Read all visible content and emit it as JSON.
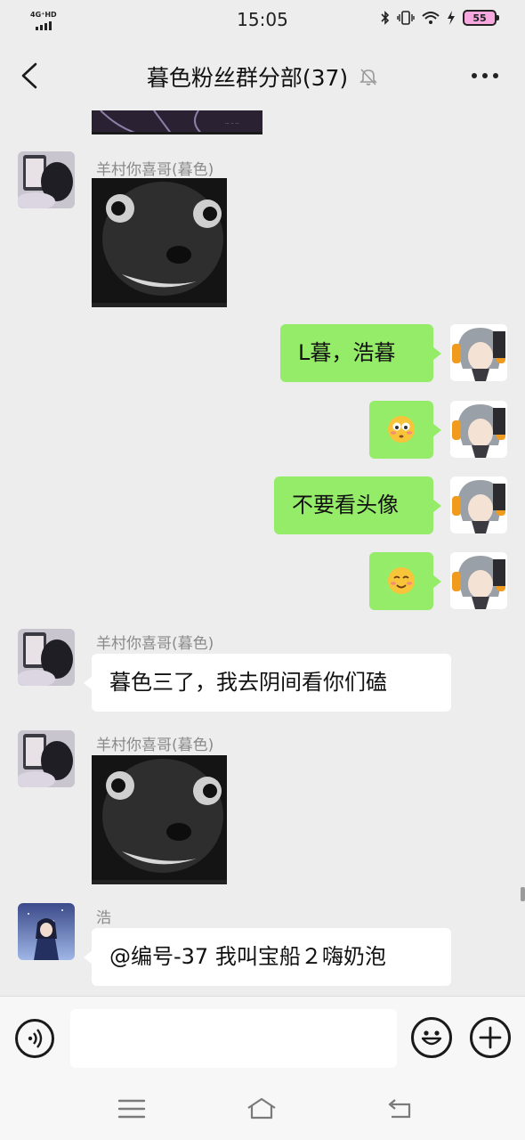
{
  "status_bar": {
    "network": "4G⁺HD",
    "time": "15:05",
    "battery": "55"
  },
  "header": {
    "title": "暮色粉丝群分部(37)"
  },
  "messages": [
    {
      "type": "image_partial",
      "direction": "in"
    },
    {
      "type": "sticker",
      "direction": "in",
      "sender": "羊村你喜哥(暮色)"
    },
    {
      "type": "text",
      "direction": "out",
      "text": "L暮，浩暮"
    },
    {
      "type": "emoji",
      "direction": "out",
      "emoji": "flushed-face"
    },
    {
      "type": "text",
      "direction": "out",
      "text": "不要看头像"
    },
    {
      "type": "emoji",
      "direction": "out",
      "emoji": "smiling-face"
    },
    {
      "type": "text",
      "direction": "in",
      "sender": "羊村你喜哥(暮色)",
      "text": "暮色三了，我去阴间看你们磕"
    },
    {
      "type": "sticker",
      "direction": "in",
      "sender": "羊村你喜哥(暮色)"
    },
    {
      "type": "text",
      "direction": "in",
      "sender": "浩",
      "text": "@编号-37  我叫宝船２嗨奶泡"
    }
  ],
  "input": {
    "placeholder": ""
  },
  "icons": {
    "back": "back-arrow-icon",
    "mute": "mute-bell-icon",
    "more": "more-dots-icon",
    "voice": "voice-icon",
    "emoji": "emoji-icon",
    "plus": "plus-icon",
    "menu": "menu-icon",
    "home": "home-icon",
    "back_nav": "return-icon"
  },
  "colors": {
    "background": "#ededed",
    "outgoing_bubble": "#95ec69",
    "incoming_bubble": "#ffffff",
    "sender_name": "#8a8a8a"
  }
}
